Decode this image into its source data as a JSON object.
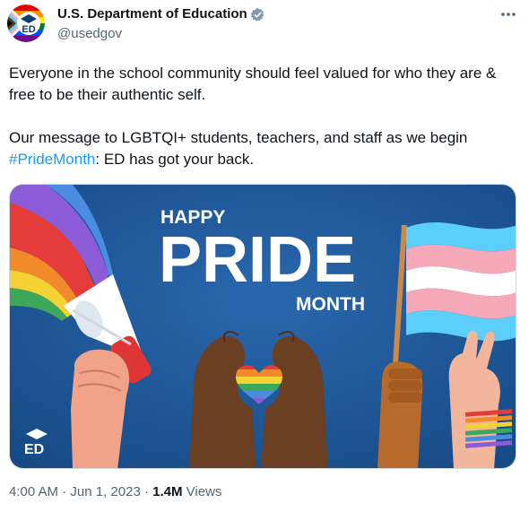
{
  "account": {
    "display_name": "U.S. Department of Education",
    "handle": "@usedgov",
    "verified": true,
    "avatar_icon": "ed-logo-icon"
  },
  "tweet": {
    "text_line1": "Everyone in the school community should feel valued for who they are &",
    "text_line2": "free to be their authentic self.",
    "text_line3_prefix": "Our message to LGBTQI+ students, teachers, and staff as we begin",
    "hashtag": "#PrideMonth",
    "text_line4_suffix": ": ED has got your back."
  },
  "media": {
    "heading_top": "HAPPY",
    "heading_main": "PRIDE",
    "heading_bottom": "MONTH",
    "background_color": "#1b4f8f"
  },
  "meta": {
    "time": "4:00 AM",
    "separator": " · ",
    "date": "Jun 1, 2023",
    "views_count": "1.4M",
    "views_label": " Views"
  },
  "colors": {
    "link": "#1d9bf0",
    "verified_badge": "#829aab",
    "secondary_text": "#536471"
  }
}
